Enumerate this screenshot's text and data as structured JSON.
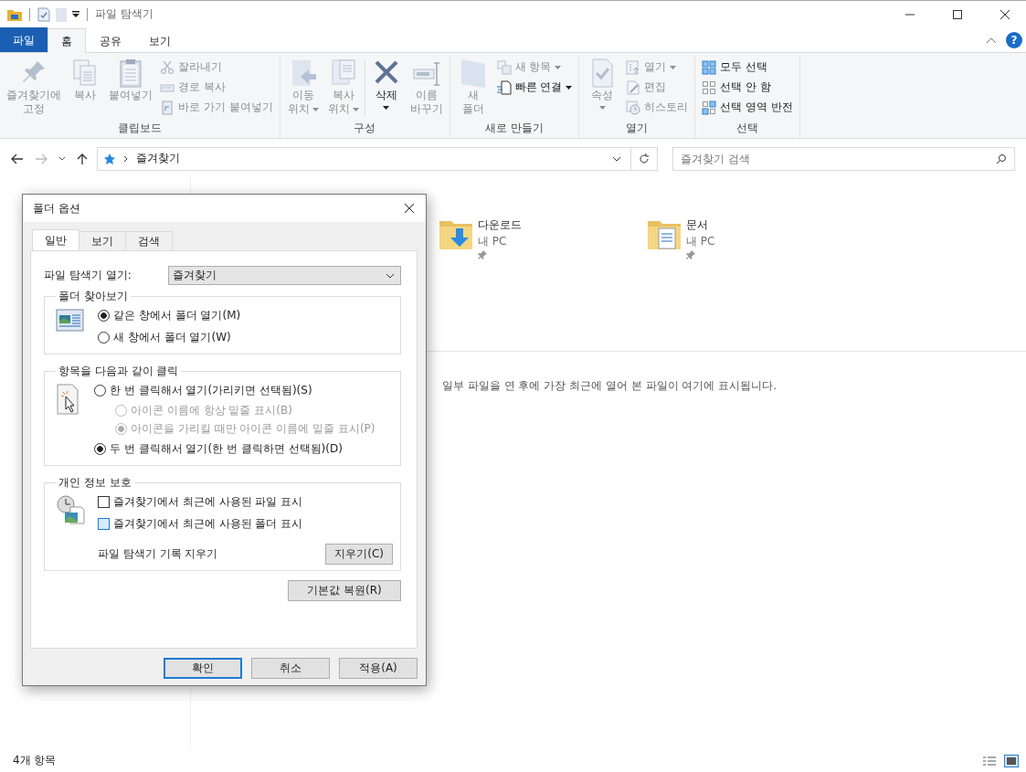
{
  "window": {
    "title": "파일 탐색기",
    "help": "?"
  },
  "ribbon_tabs": [
    {
      "label": "파일",
      "kind": "file",
      "selected": false
    },
    {
      "label": "홈",
      "kind": "tab",
      "selected": true
    },
    {
      "label": "공유",
      "kind": "tab",
      "selected": false
    },
    {
      "label": "보기",
      "kind": "tab",
      "selected": false
    }
  ],
  "ribbon_groups": [
    {
      "label": "클립보드",
      "items": [
        {
          "kind": "large",
          "lines": [
            "즐겨찾기에",
            "고정"
          ],
          "disabled": true,
          "dropdown": false
        },
        {
          "kind": "large",
          "lines": [
            "복사"
          ],
          "disabled": true,
          "dropdown": false
        },
        {
          "kind": "large",
          "lines": [
            "붙여넣기"
          ],
          "disabled": true,
          "dropdown": false
        },
        {
          "kind": "column",
          "entries": [
            {
              "label": "잘라내기",
              "disabled": true,
              "dropdown": false
            },
            {
              "label": "경로 복사",
              "disabled": true,
              "dropdown": false
            },
            {
              "label": "바로 가기 붙여넣기",
              "disabled": true,
              "dropdown": false
            }
          ]
        }
      ]
    },
    {
      "label": "구성",
      "items": [
        {
          "kind": "large",
          "lines": [
            "이동",
            "위치"
          ],
          "disabled": true,
          "dropdown": true
        },
        {
          "kind": "large",
          "lines": [
            "복사",
            "위치"
          ],
          "disabled": true,
          "dropdown": true
        },
        {
          "kind": "separator"
        },
        {
          "kind": "large",
          "lines": [
            "삭제"
          ],
          "disabled": false,
          "dropdown": true
        },
        {
          "kind": "large",
          "lines": [
            "이름",
            "바꾸기"
          ],
          "disabled": true,
          "dropdown": false
        }
      ]
    },
    {
      "label": "새로 만들기",
      "items": [
        {
          "kind": "large",
          "lines": [
            "새",
            "폴더"
          ],
          "disabled": true,
          "dropdown": false
        },
        {
          "kind": "column",
          "entries": [
            {
              "label": "새 항목",
              "disabled": true,
              "dropdown": true
            },
            {
              "label": "빠른 연결",
              "disabled": false,
              "dropdown": true
            }
          ]
        }
      ]
    },
    {
      "label": "열기",
      "items": [
        {
          "kind": "large",
          "lines": [
            "속성"
          ],
          "disabled": true,
          "dropdown": true
        },
        {
          "kind": "column",
          "entries": [
            {
              "label": "열기",
              "disabled": true,
              "dropdown": true
            },
            {
              "label": "편집",
              "disabled": true,
              "dropdown": false
            },
            {
              "label": "히스토리",
              "disabled": true,
              "dropdown": false
            }
          ]
        }
      ]
    },
    {
      "label": "선택",
      "items": [
        {
          "kind": "column",
          "entries": [
            {
              "label": "모두 선택",
              "disabled": false,
              "dropdown": false
            },
            {
              "label": "선택 안 함",
              "disabled": false,
              "dropdown": false
            },
            {
              "label": "선택 영역 반전",
              "disabled": false,
              "dropdown": false
            }
          ]
        }
      ]
    }
  ],
  "address": {
    "path": "즐겨찾기",
    "search_placeholder": "즐겨찾기 검색"
  },
  "content": {
    "folders": [
      {
        "name": "다운로드",
        "location": "내 PC"
      },
      {
        "name": "문서",
        "location": "내 PC"
      }
    ],
    "recent_message": "일부 파일을 연 후에 가장 최근에 열어 본 파일이 여기에 표시됩니다."
  },
  "status_bar": {
    "count": "4개 항목"
  },
  "dialog": {
    "title": "폴더 옵션",
    "tabs": [
      {
        "label": "일반",
        "selected": true
      },
      {
        "label": "보기",
        "selected": false
      },
      {
        "label": "검색",
        "selected": false
      }
    ],
    "open_label": "파일 탐색기 열기:",
    "open_value": "즐겨찾기",
    "groups": [
      {
        "title": "폴더 찾아보기",
        "options": [
          {
            "kind": "radio",
            "label": "같은 창에서 폴더 열기(M)",
            "selected": true,
            "disabled": false
          },
          {
            "kind": "radio",
            "label": "새 창에서 폴더 열기(W)",
            "selected": false,
            "disabled": false
          }
        ]
      },
      {
        "title": "항목을 다음과 같이 클릭",
        "options": [
          {
            "kind": "radio",
            "label": "한 번 클릭해서 열기(가리키면 선택됨)(S)",
            "selected": false,
            "disabled": false,
            "children": [
              {
                "kind": "radio",
                "label": "아이콘 이름에 항상 밑줄 표시(B)",
                "selected": false,
                "disabled": true
              },
              {
                "kind": "radio",
                "label": "아이콘을 가리킬 때만 아이콘 이름에 밑줄 표시(P)",
                "selected": true,
                "disabled": true
              }
            ]
          },
          {
            "kind": "radio",
            "label": "두 번 클릭해서 열기(한 번 클릭하면 선택됨)(D)",
            "selected": true,
            "disabled": false
          }
        ]
      },
      {
        "title": "개인 정보 보호",
        "options": [
          {
            "kind": "checkbox",
            "label": "즐겨찾기에서 최근에 사용된 파일 표시",
            "checked": false,
            "focused": false
          },
          {
            "kind": "checkbox",
            "label": "즐겨찾기에서 최근에 사용된 폴더 표시",
            "checked": false,
            "focused": true
          }
        ],
        "clear_label": "파일 탐색기 기록 지우기",
        "clear_button": "지우기(C)"
      }
    ],
    "restore_button": "기본값 복원(R)",
    "buttons": [
      {
        "label": "확인",
        "default": true
      },
      {
        "label": "취소",
        "default": false
      },
      {
        "label": "적용(A)",
        "default": false
      }
    ]
  }
}
